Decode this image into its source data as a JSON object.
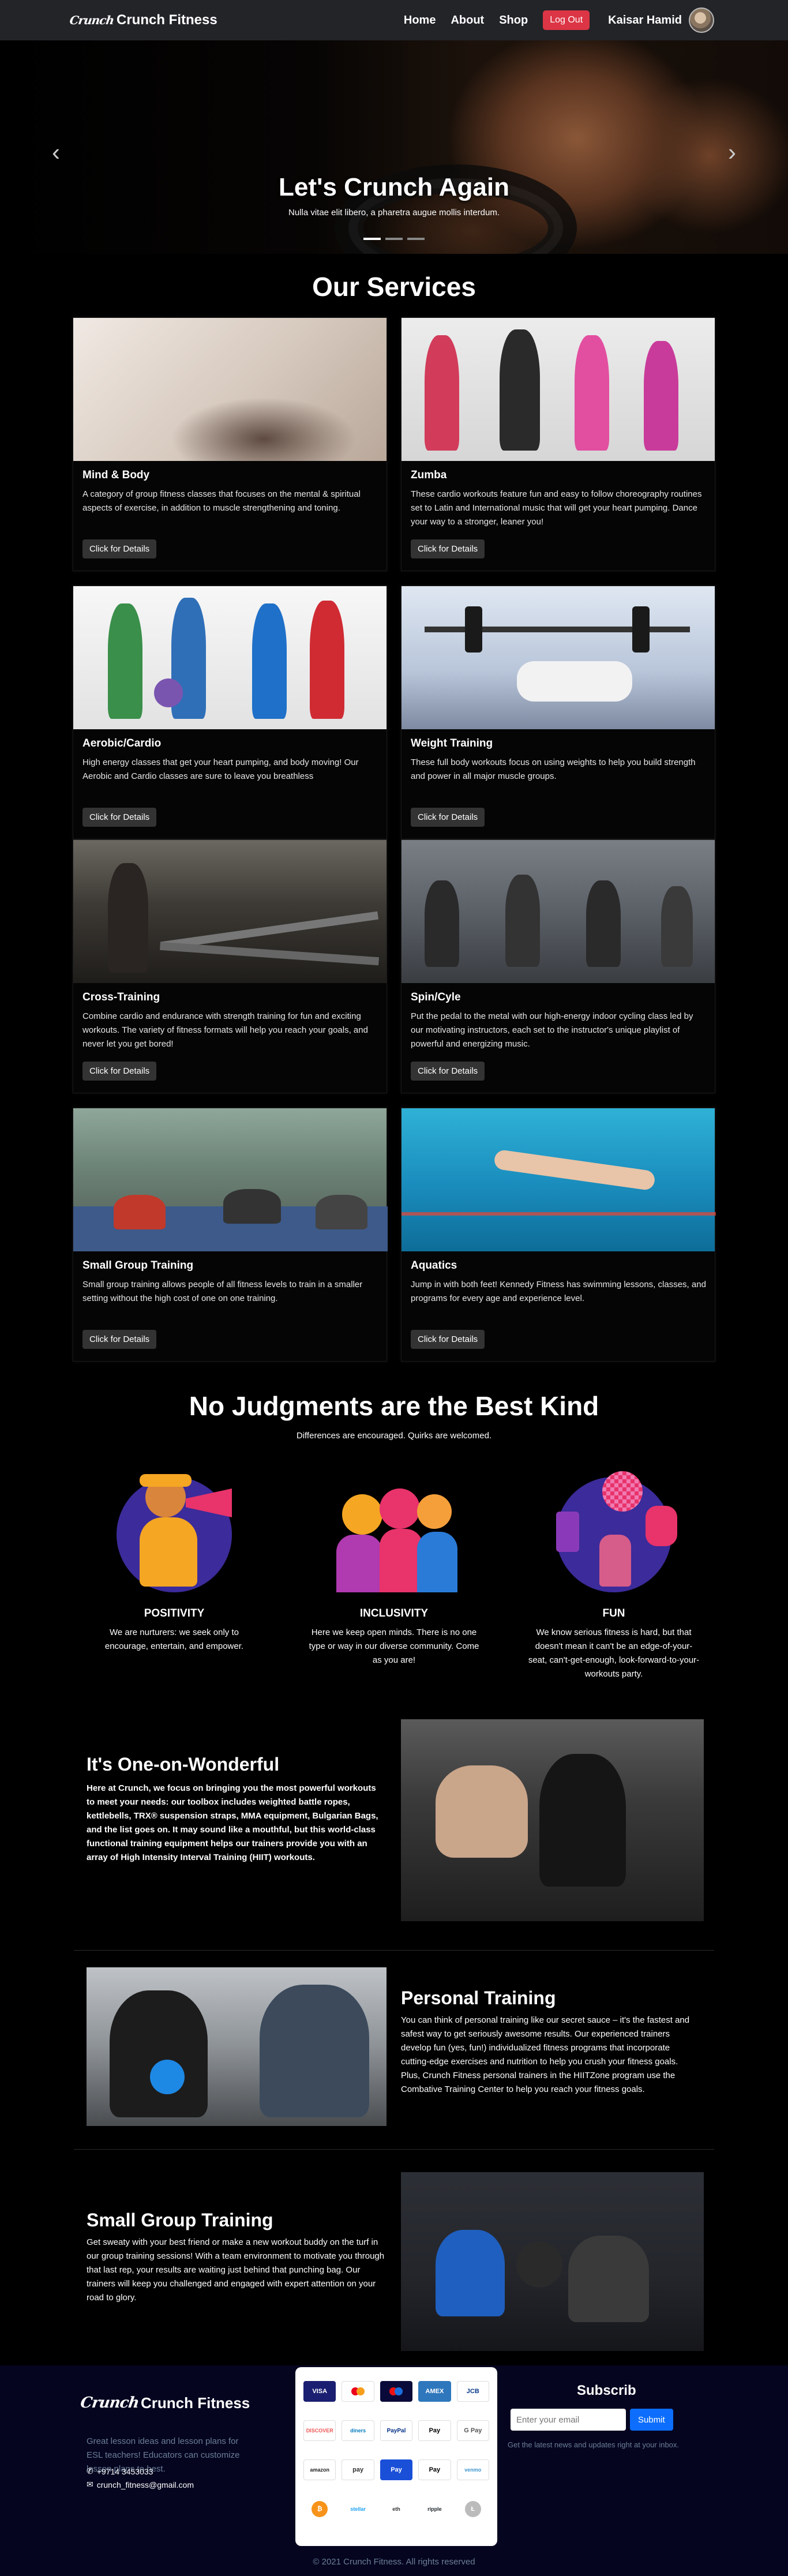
{
  "nav": {
    "brand_logo": "Crunch",
    "brand": "Crunch Fitness",
    "links": [
      "Home",
      "About",
      "Shop"
    ],
    "logout": "Log Out",
    "user": "Kaisar Hamid"
  },
  "hero": {
    "title": "Let's Crunch Again",
    "subtitle": "Nulla vitae elit libero, a pharetra augue mollis interdum.",
    "slides": 3,
    "active_slide": 1
  },
  "services": {
    "title": "Our Services",
    "button": "Click for Details",
    "items": [
      {
        "title": "Mind & Body",
        "text": "A category of group fitness classes that focuses on the mental & spiritual aspects of exercise, in addition to muscle strengthening and toning."
      },
      {
        "title": "Zumba",
        "text": "These cardio workouts feature fun and easy to follow choreography routines set to Latin and International music that will get your heart pumping. Dance your way to a stronger, leaner you!"
      },
      {
        "title": "Aerobic/Cardio",
        "text": "High energy classes that get your heart pumping, and body moving! Our Aerobic and Cardio classes are sure to leave you breathless"
      },
      {
        "title": "Weight Training",
        "text": "These full body workouts focus on using weights to help you build strength and power in all major muscle groups."
      },
      {
        "title": "Cross-Training",
        "text": "Combine cardio and endurance with strength training for fun and exciting workouts. The variety of fitness formats will help you reach your goals, and never let you get bored!"
      },
      {
        "title": "Spin/Cyle",
        "text": "Put the pedal to the metal with our high-energy indoor cycling class led by our motivating instructors, each set to the instructor's unique playlist of powerful and energizing music."
      },
      {
        "title": "Small Group Training",
        "text": "Small group training allows people of all fitness levels to train in a smaller setting without the high cost of one on one training."
      },
      {
        "title": "Aquatics",
        "text": "Jump in with both feet! Kennedy Fitness has swimming lessons, classes, and programs for every age and experience level."
      }
    ]
  },
  "judgments": {
    "title": "No Judgments are the Best Kind",
    "subtitle": "Differences are encouraged. Quirks are welcomed.",
    "features": [
      {
        "title": "POSITIVITY",
        "text": "We are nurturers: we seek only to encourage, entertain, and empower."
      },
      {
        "title": "INCLUSIVITY",
        "text": "Here we keep open minds. There is no one type or way in our diverse community. Come as you are!"
      },
      {
        "title": "FUN",
        "text": "We know serious fitness is hard, but that doesn't mean it can't be an edge-of-your-seat, can't-get-enough, look-forward-to-your-workouts party."
      }
    ]
  },
  "info": [
    {
      "title": "It's One-on-Wonderful",
      "text": "Here at Crunch, we focus on bringing you the most powerful workouts to meet your needs: our toolbox includes weighted battle ropes, kettlebells, TRX® suspension straps, MMA equipment, Bulgarian Bags, and the list goes on. It may sound like a mouthful, but this world-class functional training equipment helps our trainers provide you with an array of High Intensity Interval Training (HIIT) workouts."
    },
    {
      "title": "Personal Training",
      "text": "You can think of personal training like our secret sauce – it's the fastest and safest way to get seriously awesome results. Our experienced trainers develop fun (yes, fun!) individualized fitness programs that incorporate cutting-edge exercises and nutrition to help you crush your fitness goals. Plus, Crunch Fitness personal trainers in the HIITZone program use the Combative Training Center to help you reach your fitness goals."
    },
    {
      "title": "Small Group Training",
      "text": "Get sweaty with your best friend or make a new workout buddy on the turf in our group training sessions! With a team environment to motivate you through that last rep, your results are waiting just behind that punching bag. Our trainers will keep you challenged and engaged with expert attention on your road to glory."
    }
  ],
  "footer": {
    "brand_logo": "Crunch",
    "brand": "Crunch Fitness",
    "description": "Great lesson ideas and lesson plans for ESL teachers! Educators can customize lesson plans to best.",
    "phone": "+9714 3453033",
    "email": "crunch_fitness@gmail.com",
    "payments": [
      "VISA",
      "mastercard",
      "maestro",
      "AMEX",
      "JCB",
      "DISCOVER",
      "diners",
      "PayPal",
      "Pay",
      "G Pay",
      "amazon",
      "pay",
      "Pay",
      "Pay",
      "venmo",
      "",
      "stellar",
      "eth",
      "ripple",
      ""
    ],
    "subscribe_title": "Subscrib",
    "subscribe_placeholder": "Enter your email",
    "subscribe_button": "Submit",
    "subscribe_note": "Get the latest news and updates right at your inbox.",
    "copyright": "© 2021 Crunch Fitness. All rights reserved"
  },
  "colors": {
    "logout": "#dc3545",
    "subscribe": "#0d6efd",
    "footer_bg": "#050520",
    "navbar_bg": "#222428"
  }
}
